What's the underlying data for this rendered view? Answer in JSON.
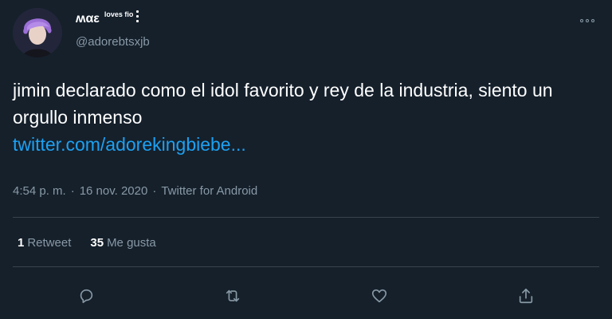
{
  "author": {
    "display_name": "ʍαε",
    "display_name_extra": "loves fio",
    "handle": "@adorebtsxjb"
  },
  "tweet": {
    "text": "jimin declarado como el idol favorito y rey de la industria, siento un orgullo inmenso",
    "link": "twitter.com/adorekingbiebe...",
    "time": "4:54 p. m.",
    "date": "16 nov. 2020",
    "source": "Twitter for Android",
    "separator": "·"
  },
  "stats": {
    "retweets_count": "1",
    "retweets_label": "Retweet",
    "likes_count": "35",
    "likes_label": "Me gusta"
  },
  "icons": {
    "more": "more-horizontal-icon",
    "reply": "reply-icon",
    "retweet": "retweet-icon",
    "like": "heart-icon",
    "share": "share-icon"
  },
  "colors": {
    "background": "#15202b",
    "text": "#ffffff",
    "secondary": "#8899a6",
    "link": "#1da1f2",
    "divider": "#38444d"
  }
}
